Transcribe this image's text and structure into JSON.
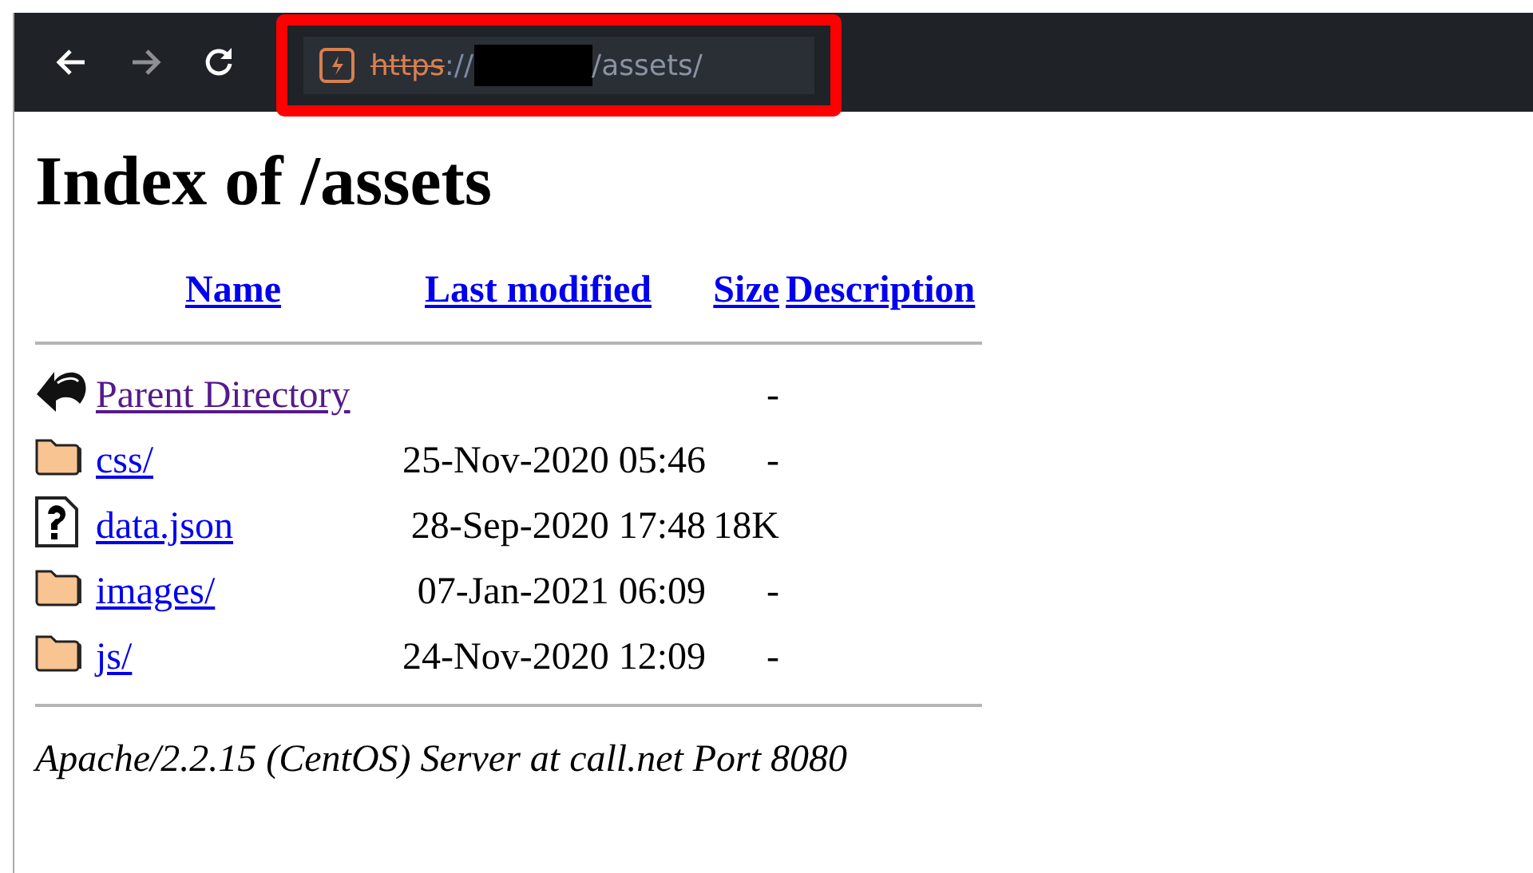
{
  "toolbar": {
    "url": {
      "scheme": "https",
      "separator": "://",
      "path": "/assets/",
      "insecure": true
    }
  },
  "heading": "Index of /assets",
  "columns": [
    "Name",
    "Last modified",
    "Size",
    "Description"
  ],
  "rows": [
    {
      "kind": "back",
      "name": "Parent Directory",
      "visited": true,
      "size": "-"
    },
    {
      "kind": "folder",
      "name": "css/",
      "visited": false,
      "modified": "25-Nov-2020 05:46",
      "size": "-"
    },
    {
      "kind": "unknown",
      "name": "data.json",
      "visited": false,
      "modified": "28-Sep-2020 17:48",
      "size": "18K"
    },
    {
      "kind": "folder",
      "name": "images/",
      "visited": false,
      "modified": "07-Jan-2021 06:09",
      "size": "-"
    },
    {
      "kind": "folder",
      "name": "js/",
      "visited": false,
      "modified": "24-Nov-2020 12:09",
      "size": "-"
    }
  ],
  "footer": "Apache/2.2.15 (CentOS) Server at call.net Port 8080"
}
